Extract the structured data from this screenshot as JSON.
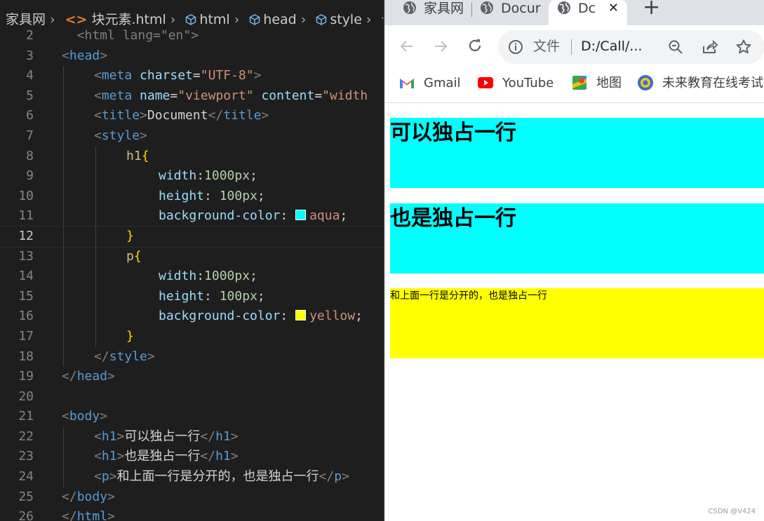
{
  "editor": {
    "breadcrumb": [
      "家具网",
      "块元素.html",
      "html",
      "head",
      "style"
    ],
    "breadcrumb_tail": "仓",
    "lines": [
      {
        "n": "2",
        "indent": 0,
        "tokens": [
          {
            "t": "  <html lang=\"en\">",
            "c": "t-br"
          }
        ]
      },
      {
        "n": "3",
        "indent": 0,
        "tokens": [
          {
            "t": "<",
            "c": "t-br"
          },
          {
            "t": "head",
            "c": "t-tag"
          },
          {
            "t": ">",
            "c": "t-br"
          }
        ]
      },
      {
        "n": "4",
        "indent": 1,
        "tokens": [
          {
            "t": "<",
            "c": "t-br"
          },
          {
            "t": "meta",
            "c": "t-tag"
          },
          {
            "t": " charset",
            "c": "t-attr"
          },
          {
            "t": "=",
            "c": "t-text"
          },
          {
            "t": "\"UTF-8\"",
            "c": "t-str"
          },
          {
            "t": ">",
            "c": "t-br"
          }
        ]
      },
      {
        "n": "5",
        "indent": 1,
        "tokens": [
          {
            "t": "<",
            "c": "t-br"
          },
          {
            "t": "meta",
            "c": "t-tag"
          },
          {
            "t": " name",
            "c": "t-attr"
          },
          {
            "t": "=",
            "c": "t-text"
          },
          {
            "t": "\"viewport\"",
            "c": "t-str"
          },
          {
            "t": " content",
            "c": "t-attr"
          },
          {
            "t": "=",
            "c": "t-text"
          },
          {
            "t": "\"width",
            "c": "t-str"
          }
        ]
      },
      {
        "n": "6",
        "indent": 1,
        "tokens": [
          {
            "t": "<",
            "c": "t-br"
          },
          {
            "t": "title",
            "c": "t-tag"
          },
          {
            "t": ">",
            "c": "t-br"
          },
          {
            "t": "Document",
            "c": "t-text"
          },
          {
            "t": "</",
            "c": "t-br"
          },
          {
            "t": "title",
            "c": "t-tag"
          },
          {
            "t": ">",
            "c": "t-br"
          }
        ]
      },
      {
        "n": "7",
        "indent": 1,
        "tokens": [
          {
            "t": "<",
            "c": "t-br"
          },
          {
            "t": "style",
            "c": "t-tag"
          },
          {
            "t": ">",
            "c": "t-br"
          }
        ]
      },
      {
        "n": "8",
        "indent": 2,
        "tokens": [
          {
            "t": "h1",
            "c": "t-sel"
          },
          {
            "t": "{",
            "c": "t-brace"
          }
        ]
      },
      {
        "n": "9",
        "indent": 3,
        "tokens": [
          {
            "t": "width",
            "c": "t-prop"
          },
          {
            "t": ":",
            "c": "t-text"
          },
          {
            "t": "1000px",
            "c": "t-num"
          },
          {
            "t": ";",
            "c": "t-text"
          }
        ]
      },
      {
        "n": "10",
        "indent": 3,
        "tokens": [
          {
            "t": "height",
            "c": "t-prop"
          },
          {
            "t": ": ",
            "c": "t-text"
          },
          {
            "t": "100px",
            "c": "t-num"
          },
          {
            "t": ";",
            "c": "t-text"
          }
        ]
      },
      {
        "n": "11",
        "indent": 3,
        "tokens": [
          {
            "t": "background-color",
            "c": "t-prop"
          },
          {
            "t": ": ",
            "c": "t-text"
          },
          {
            "swatch": "#00ffff"
          },
          {
            "t": "aqua",
            "c": "t-str"
          },
          {
            "t": ";",
            "c": "t-text"
          }
        ]
      },
      {
        "n": "12",
        "indent": 2,
        "active": true,
        "tokens": [
          {
            "t": "}",
            "c": "t-brace"
          }
        ]
      },
      {
        "n": "13",
        "indent": 2,
        "tokens": [
          {
            "t": "p",
            "c": "t-sel"
          },
          {
            "t": "{",
            "c": "t-brace"
          }
        ]
      },
      {
        "n": "14",
        "indent": 3,
        "tokens": [
          {
            "t": "width",
            "c": "t-prop"
          },
          {
            "t": ":",
            "c": "t-text"
          },
          {
            "t": "1000px",
            "c": "t-num"
          },
          {
            "t": ";",
            "c": "t-text"
          }
        ]
      },
      {
        "n": "15",
        "indent": 3,
        "tokens": [
          {
            "t": "height",
            "c": "t-prop"
          },
          {
            "t": ": ",
            "c": "t-text"
          },
          {
            "t": "100px",
            "c": "t-num"
          },
          {
            "t": ";",
            "c": "t-text"
          }
        ]
      },
      {
        "n": "16",
        "indent": 3,
        "tokens": [
          {
            "t": "background-color",
            "c": "t-prop"
          },
          {
            "t": ": ",
            "c": "t-text"
          },
          {
            "swatch": "#ffff00"
          },
          {
            "t": "yellow",
            "c": "t-str"
          },
          {
            "t": ";",
            "c": "t-text"
          }
        ]
      },
      {
        "n": "17",
        "indent": 2,
        "tokens": [
          {
            "t": "}",
            "c": "t-brace"
          }
        ]
      },
      {
        "n": "18",
        "indent": 1,
        "tokens": [
          {
            "t": "</",
            "c": "t-br"
          },
          {
            "t": "style",
            "c": "t-tag"
          },
          {
            "t": ">",
            "c": "t-br"
          }
        ]
      },
      {
        "n": "19",
        "indent": 0,
        "tokens": [
          {
            "t": "</",
            "c": "t-br"
          },
          {
            "t": "head",
            "c": "t-tag"
          },
          {
            "t": ">",
            "c": "t-br"
          }
        ]
      },
      {
        "n": "20",
        "indent": 0,
        "tokens": []
      },
      {
        "n": "21",
        "indent": 0,
        "tokens": [
          {
            "t": "<",
            "c": "t-br"
          },
          {
            "t": "body",
            "c": "t-tag"
          },
          {
            "t": ">",
            "c": "t-br"
          }
        ]
      },
      {
        "n": "22",
        "indent": 1,
        "tokens": [
          {
            "t": "<",
            "c": "t-br"
          },
          {
            "t": "h1",
            "c": "t-tag"
          },
          {
            "t": ">",
            "c": "t-br"
          },
          {
            "t": "可以独占一行",
            "c": "t-text"
          },
          {
            "t": "</",
            "c": "t-br"
          },
          {
            "t": "h1",
            "c": "t-tag"
          },
          {
            "t": ">",
            "c": "t-br"
          }
        ]
      },
      {
        "n": "23",
        "indent": 1,
        "tokens": [
          {
            "t": "<",
            "c": "t-br"
          },
          {
            "t": "h1",
            "c": "t-tag"
          },
          {
            "t": ">",
            "c": "t-br"
          },
          {
            "t": "也是独占一行",
            "c": "t-text"
          },
          {
            "t": "</",
            "c": "t-br"
          },
          {
            "t": "h1",
            "c": "t-tag"
          },
          {
            "t": ">",
            "c": "t-br"
          }
        ]
      },
      {
        "n": "24",
        "indent": 1,
        "tokens": [
          {
            "t": "<",
            "c": "t-br"
          },
          {
            "t": "p",
            "c": "t-tag"
          },
          {
            "t": ">",
            "c": "t-br"
          },
          {
            "t": "和上面一行是分开的，也是独占一行",
            "c": "t-text"
          },
          {
            "t": "</",
            "c": "t-br"
          },
          {
            "t": "p",
            "c": "t-tag"
          },
          {
            "t": ">",
            "c": "t-br"
          }
        ]
      },
      {
        "n": "25",
        "indent": 0,
        "tokens": [
          {
            "t": "</",
            "c": "t-br"
          },
          {
            "t": "body",
            "c": "t-tag"
          },
          {
            "t": ">",
            "c": "t-br"
          }
        ]
      },
      {
        "n": "26",
        "indent": 0,
        "tokens": [
          {
            "t": "</",
            "c": "t-br"
          },
          {
            "t": "html",
            "c": "t-tag"
          },
          {
            "t": ">",
            "c": "t-br"
          }
        ]
      }
    ]
  },
  "browser": {
    "tabs": [
      {
        "label": "家具网"
      },
      {
        "label": "Docur"
      },
      {
        "label": "Dc"
      }
    ],
    "new_tab_label": "+",
    "close_label": "✕",
    "address": {
      "prefix": "文件",
      "url": "D:/Call/..."
    },
    "bookmarks": [
      {
        "label": "Gmail",
        "icon": "gmail-icon"
      },
      {
        "label": "YouTube",
        "icon": "youtube-icon"
      },
      {
        "label": "地图",
        "icon": "maps-icon"
      },
      {
        "label": "未来教育在线考试",
        "icon": "exam-site-icon"
      }
    ],
    "page": {
      "h1_first": "可以独占一行",
      "h1_second": "也是独占一行",
      "paragraph": "和上面一行是分开的，也是独占一行"
    },
    "colors": {
      "h1_bg": "#00ffff",
      "p_bg": "#ffff00"
    },
    "watermark": "CSDN @V424"
  }
}
